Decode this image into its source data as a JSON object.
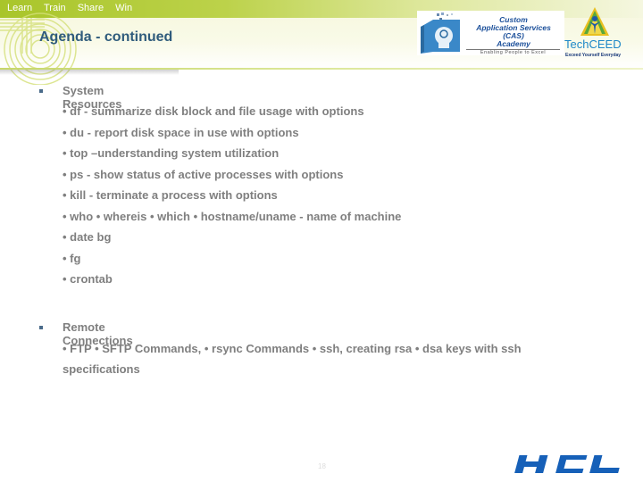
{
  "header": {
    "tagline": [
      "Learn",
      "Train",
      "Share",
      "Win"
    ],
    "title": "Agenda - continued"
  },
  "logos": {
    "cas": {
      "line1": "Custom",
      "line2": "Application Services",
      "line3": "(CAS)",
      "line4": "Academy",
      "subtitle": "Enabling People to Excel"
    },
    "techceed": {
      "name_part1": "Tech",
      "name_part2": "CEED",
      "tagline": "Exceed Yourself Everyday"
    },
    "hcl": "HCL"
  },
  "sections": [
    {
      "heading": "System Resources",
      "items": [
        "• df - summarize disk block and file usage  with options",
        "• du - report disk space in use with options",
        "• top –understanding system utilization",
        "• ps - show status of active processes with options",
        "• kill - terminate a process  with options",
        "• who • whereis • which • hostname/uname - name of machine",
        "• date bg",
        "• fg",
        "• crontab"
      ]
    },
    {
      "heading": "Remote Connections",
      "items": [
        "• FTP  • SFTP Commands, • rsync Commands • ssh, creating rsa • dsa keys with ssh",
        "specifications"
      ]
    }
  ],
  "footer": {
    "page_number": "18"
  },
  "colors": {
    "title": "#2f5b7c",
    "body_text": "#7f7f7f",
    "accent_green": "#a9c52a",
    "hcl_blue": "#1660b8"
  }
}
